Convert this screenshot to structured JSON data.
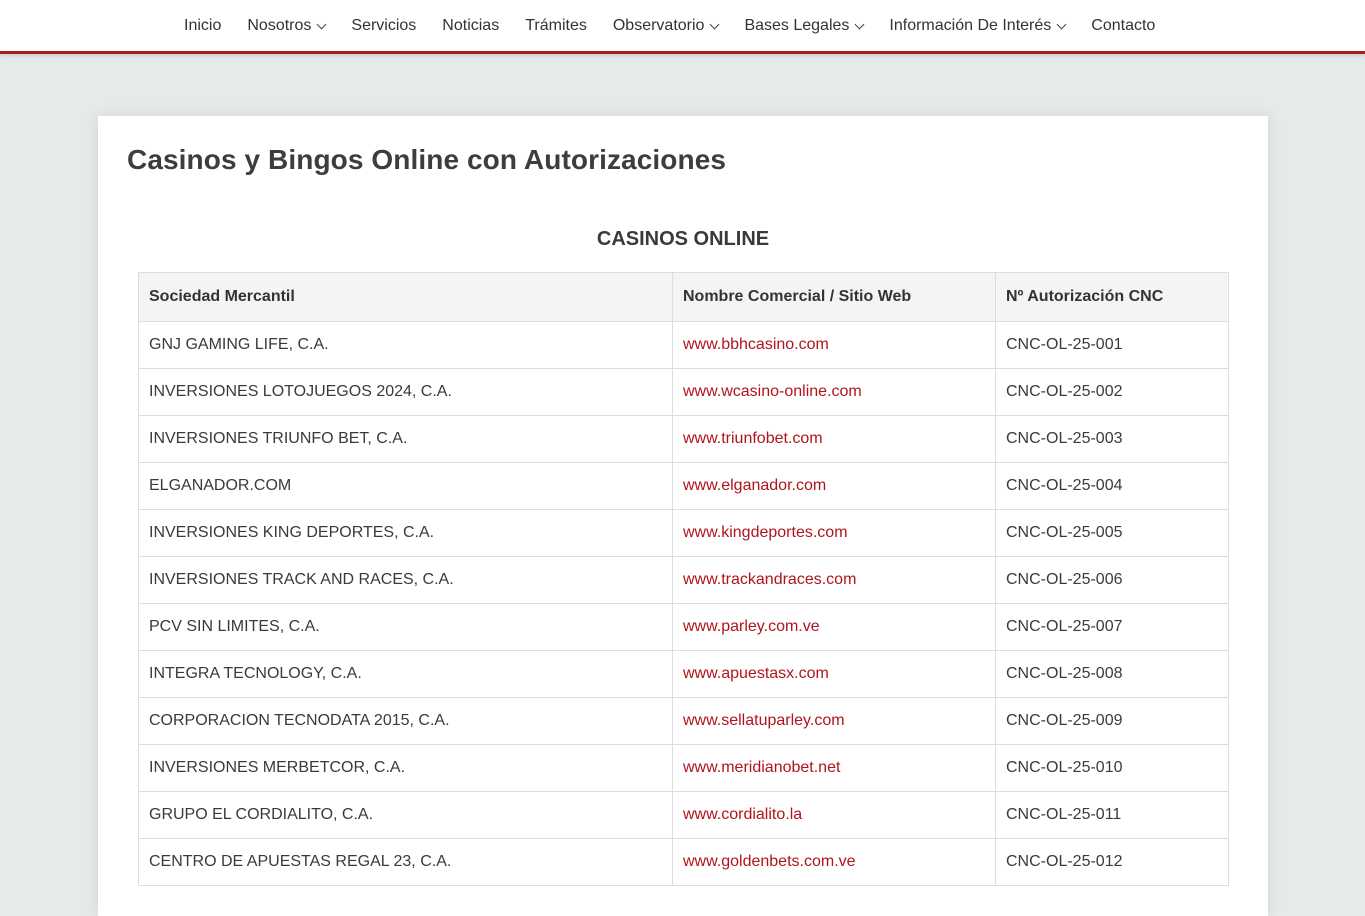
{
  "nav": {
    "items": [
      {
        "label": "Inicio",
        "dropdown": false
      },
      {
        "label": "Nosotros",
        "dropdown": true
      },
      {
        "label": "Servicios",
        "dropdown": false
      },
      {
        "label": "Noticias",
        "dropdown": false
      },
      {
        "label": "Trámites",
        "dropdown": false
      },
      {
        "label": "Observatorio",
        "dropdown": true
      },
      {
        "label": "Bases Legales",
        "dropdown": true
      },
      {
        "label": "Información De Interés",
        "dropdown": true
      },
      {
        "label": "Contacto",
        "dropdown": false
      }
    ]
  },
  "page": {
    "title": "Casinos y Bingos Online con Autorizaciones",
    "section_title": "CASINOS ONLINE"
  },
  "table": {
    "headers": [
      "Sociedad Mercantil",
      "Nombre Comercial / Sitio Web",
      "Nº Autorización CNC"
    ],
    "rows": [
      [
        "GNJ GAMING LIFE, C.A.",
        "www.bbhcasino.com",
        "CNC-OL-25-001"
      ],
      [
        "INVERSIONES LOTOJUEGOS 2024, C.A.",
        "www.wcasino-online.com",
        "CNC-OL-25-002"
      ],
      [
        "INVERSIONES TRIUNFO BET, C.A.",
        "www.triunfobet.com",
        "CNC-OL-25-003"
      ],
      [
        "ELGANADOR.COM",
        "www.elganador.com",
        "CNC-OL-25-004"
      ],
      [
        "INVERSIONES KING DEPORTES, C.A.",
        "www.kingdeportes.com",
        "CNC-OL-25-005"
      ],
      [
        "INVERSIONES TRACK AND RACES, C.A.",
        "www.trackandraces.com",
        "CNC-OL-25-006"
      ],
      [
        "PCV SIN LIMITES, C.A.",
        "www.parley.com.ve",
        "CNC-OL-25-007"
      ],
      [
        "INTEGRA TECNOLOGY, C.A.",
        "www.apuestasx.com",
        "CNC-OL-25-008"
      ],
      [
        "CORPORACION TECNODATA 2015, C.A.",
        "www.sellatuparley.com",
        "CNC-OL-25-009"
      ],
      [
        "INVERSIONES MERBETCOR, C.A.",
        "www.meridianobet.net",
        "CNC-OL-25-010"
      ],
      [
        "GRUPO EL CORDIALITO, C.A.",
        "www.cordialito.la",
        "CNC-OL-25-011"
      ],
      [
        "CENTRO DE APUESTAS REGAL 23, C.A.",
        "www.goldenbets.com.ve",
        "CNC-OL-25-012"
      ]
    ]
  },
  "colors": {
    "accent": "#a91f24",
    "link": "#b0141c",
    "background": "#e5ebe8"
  }
}
